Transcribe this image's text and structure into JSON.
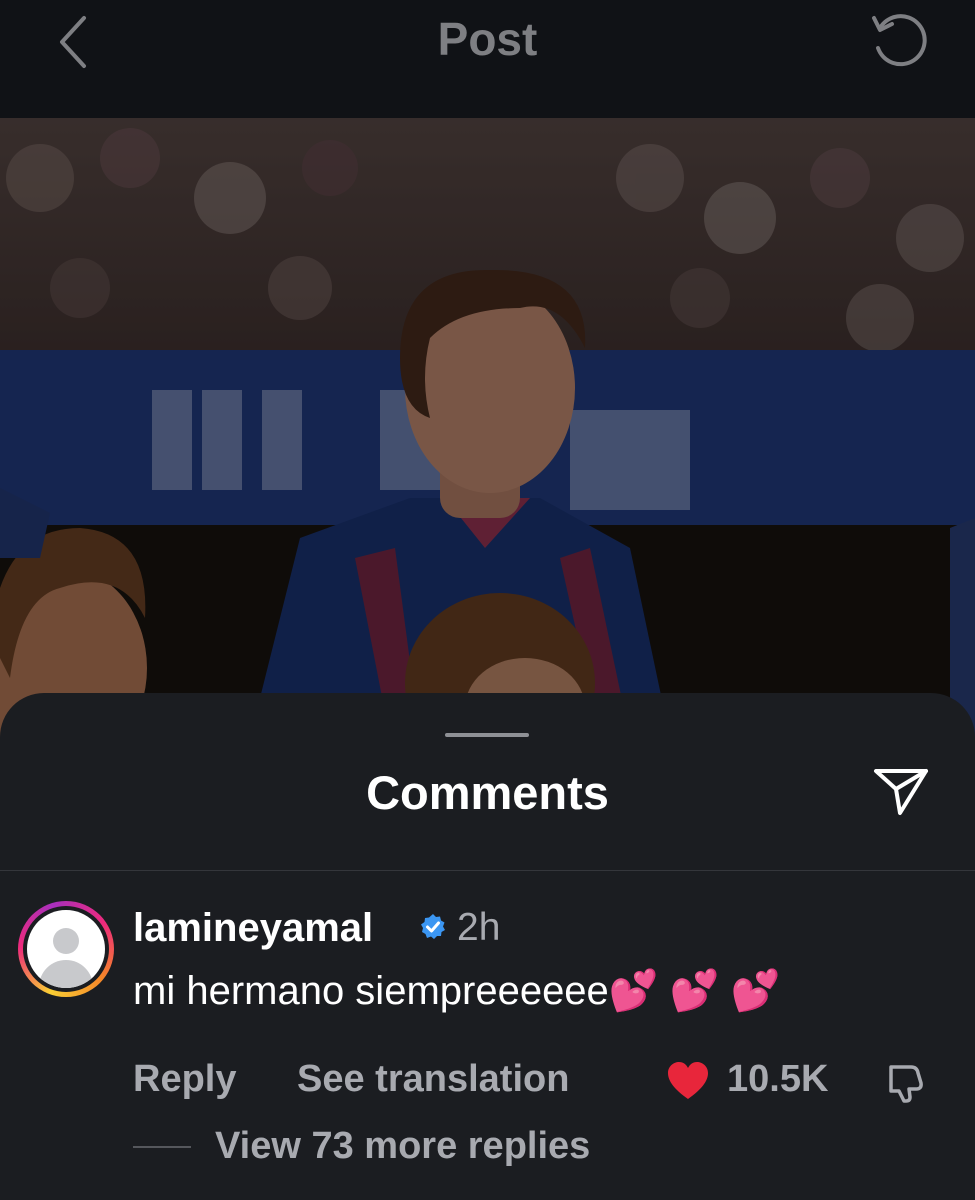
{
  "header": {
    "title": "Post",
    "back_icon": "chevron-left-icon",
    "refresh_icon": "refresh-icon"
  },
  "post": {
    "image_description_icon": "photo"
  },
  "comments_sheet": {
    "title": "Comments",
    "share_icon": "send-icon"
  },
  "comment": {
    "username": "lamineyamal",
    "verified": true,
    "time": "2h",
    "text": "mi hermano siempreeeeee💕 💕 💕",
    "reply_label": "Reply",
    "translation_label": "See translation",
    "like_count": "10.5K",
    "replies_label": "View 73 more replies"
  },
  "colors": {
    "background": "#1b1d21",
    "topbar": "#101216",
    "muted_text": "#a8aab0",
    "like": "#e8263b",
    "verified": "#3b96f2"
  }
}
